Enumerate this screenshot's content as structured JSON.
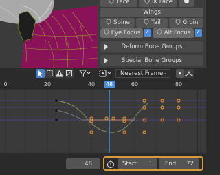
{
  "bone_collections": {
    "row1": [
      "Face",
      "IK Face"
    ],
    "wings_label": "Wings",
    "row3": [
      "Spine",
      "Tail",
      "Groin"
    ],
    "row4": [
      "Eye Focus",
      "Alt Focus"
    ],
    "checkmark": "✓"
  },
  "panels": {
    "deform_label": "Deform Bone Groups",
    "special_label": "Special Bone Groups"
  },
  "graph_toolbar": {
    "snap_mode": "Nearest Frame",
    "icons": [
      "select-cursor-icon",
      "box-select-icon",
      "warning-icon",
      "normalize-icon",
      "filter-icon",
      "pivot-icon",
      "proportional-icon",
      "curve-icon"
    ]
  },
  "ruler": {
    "ticks": [
      "0",
      "20",
      "40",
      "48",
      "60",
      "80"
    ],
    "current_frame": "48"
  },
  "footer": {
    "current_frame": "48",
    "start_label": "Start",
    "start_value": "1",
    "end_label": "End",
    "end_value": "72"
  },
  "colors": {
    "accent": "#4a8cd9",
    "keyframe": "#e08a2c",
    "viewport_bg": "#8a1259",
    "highlight_border": "#d89b3a"
  }
}
